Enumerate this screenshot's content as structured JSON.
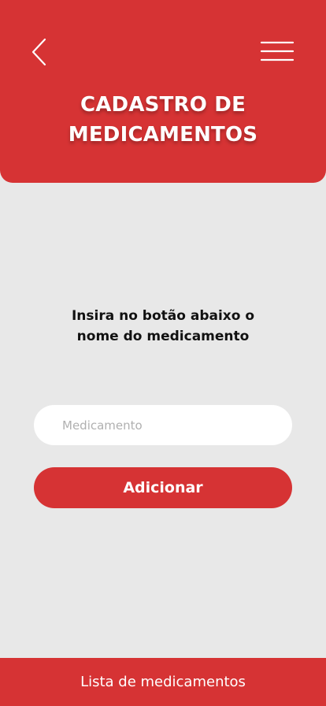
{
  "header": {
    "title_line1": "CADASTRO DE",
    "title_line2": "MEDICAMENTOS",
    "back_icon": "chevron-left-icon",
    "menu_icon": "hamburger-menu-icon"
  },
  "main": {
    "instruction_line1": "Insira no botão abaixo o",
    "instruction_line2": "nome do medicamento",
    "medication_input": {
      "placeholder": "Medicamento",
      "value": ""
    },
    "add_button_label": "Adicionar"
  },
  "footer": {
    "label": "Lista de medicamentos"
  },
  "colors": {
    "brand_red": "#d63334",
    "background": "#e8e8e8",
    "input_background": "#ffffff",
    "text_dark": "#111111"
  }
}
